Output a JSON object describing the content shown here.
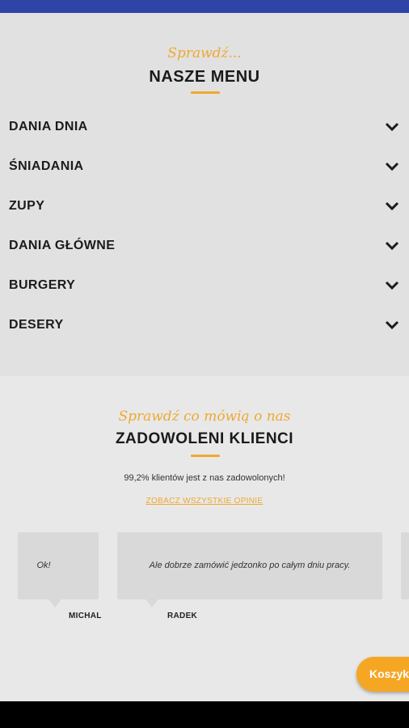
{
  "menu": {
    "script_subtitle": "Sprawdź...",
    "title": "NASZE MENU",
    "items": [
      {
        "label": "DANIA DNIA"
      },
      {
        "label": "ŚNIADANIA"
      },
      {
        "label": "ZUPY"
      },
      {
        "label": "DANIA GŁÓWNE"
      },
      {
        "label": "BURGERY"
      },
      {
        "label": "DESERY"
      }
    ]
  },
  "reviews": {
    "script_subtitle": "Sprawdź co mówią o nas",
    "title": "ZADOWOLENI KLIENCI",
    "summary": "99,2% klientów jest z nas zadowolonych!",
    "all_link": "ZOBACZ WSZYSTKIE OPINIE",
    "cards": [
      {
        "text": "Ok!",
        "author": "MICHAL"
      },
      {
        "text": "Ale dobrze zamówić jedzonko po całym dniu pracy.",
        "author": "RADEK"
      }
    ]
  },
  "cart": {
    "label": "Koszyk"
  },
  "colors": {
    "accent": "#f0a830",
    "status_bar": "#3043a6",
    "cart": "#f5a623"
  }
}
